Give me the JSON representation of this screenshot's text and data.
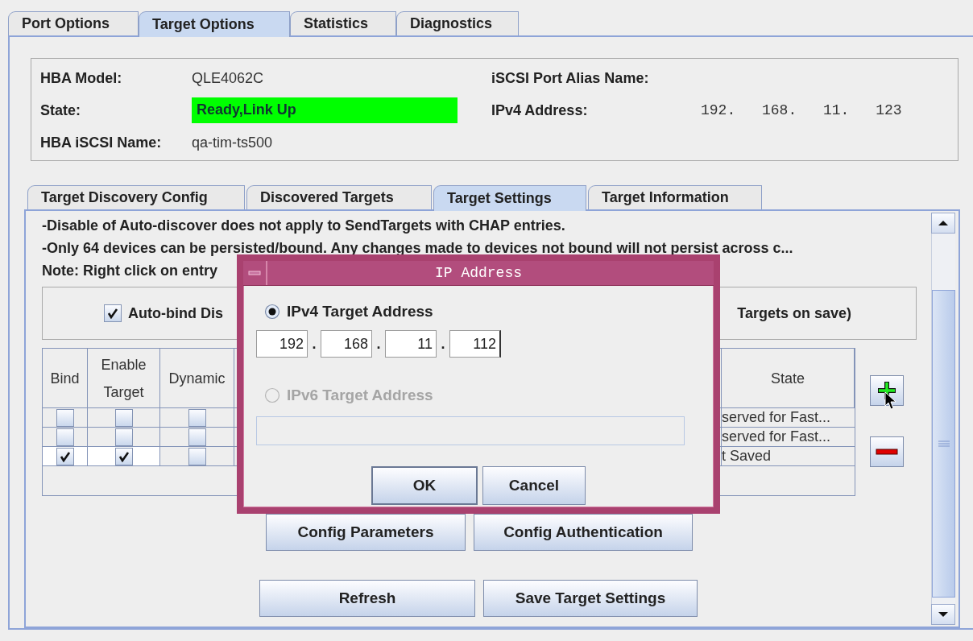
{
  "tabs": [
    {
      "label": "Port Options",
      "selected": false
    },
    {
      "label": "Target Options",
      "selected": true
    },
    {
      "label": "Statistics",
      "selected": false
    },
    {
      "label": "Diagnostics",
      "selected": false
    }
  ],
  "hba_info": {
    "left": [
      {
        "label": "HBA Model:",
        "value": "QLE4062C"
      },
      {
        "label": "State:",
        "value": "Ready,Link Up",
        "color": "#00ff00"
      },
      {
        "label": "HBA iSCSI Name:",
        "value": "qa-tim-ts500"
      }
    ],
    "right": [
      {
        "label": "iSCSI Port Alias Name:"
      },
      {
        "label": "IPv4 Address:",
        "value": "192. 168. 11. 123"
      }
    ]
  },
  "sub_tabs": [
    {
      "label": "Target Discovery Config",
      "selected": false
    },
    {
      "label": "Discovered Targets",
      "selected": false
    },
    {
      "label": "Target Settings",
      "selected": true
    },
    {
      "label": "Target Information",
      "selected": false
    }
  ],
  "notes": [
    "-Disable of Auto-discover does not apply to SendTargets with CHAP entries.",
    "-Only 64 devices can be persisted/bound. Any changes made to devices not bound will not persist across c...",
    "Note: Right click on entry"
  ],
  "auto_bind": {
    "checked": true,
    "label": "Auto-bind Dis",
    "label_end": "Targets on save)"
  },
  "table": {
    "columns": [
      "Bind",
      "Enable Target",
      "Dynamic",
      "State"
    ],
    "rows": [
      {
        "bind": false,
        "enable_target": false,
        "dynamic": false,
        "state": "served for Fast..."
      },
      {
        "bind": false,
        "enable_target": false,
        "dynamic": false,
        "state": "served for Fast..."
      },
      {
        "bind": true,
        "enable_target": true,
        "dynamic": false,
        "state": "t Saved"
      }
    ]
  },
  "button_rows": [
    [
      "Config Parameters",
      "Config Authentication"
    ],
    [
      "Refresh",
      "Save Target Settings"
    ]
  ],
  "dialog": {
    "title": "IP Address",
    "octet_separator": ".",
    "options": [
      {
        "kind": "ipv4",
        "label": "IPv4 Target Address",
        "selected": true,
        "disabled": false,
        "octets": [
          "192",
          "168",
          "11",
          "112"
        ]
      },
      {
        "kind": "ipv6",
        "label": "IPv6 Target Address",
        "selected": false,
        "disabled": true
      }
    ],
    "buttons": [
      "OK",
      "Cancel"
    ]
  }
}
